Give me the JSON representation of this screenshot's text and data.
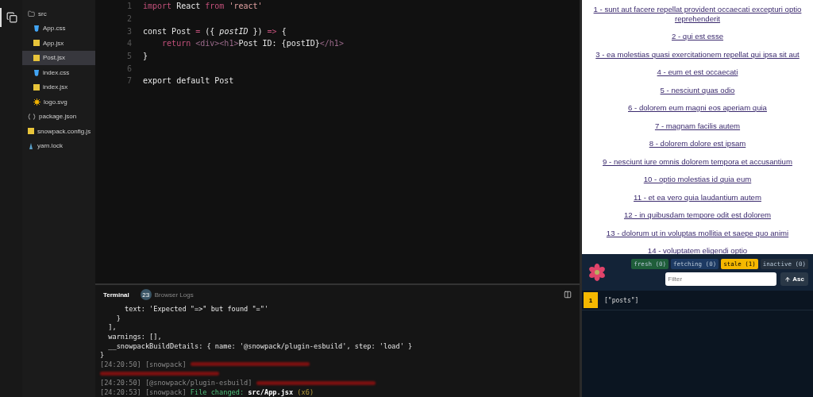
{
  "explorer": {
    "folder": "src",
    "files": [
      {
        "name": "App.css",
        "kind": "css",
        "selected": false,
        "nested": true
      },
      {
        "name": "App.jsx",
        "kind": "jsx",
        "selected": false,
        "nested": true
      },
      {
        "name": "Post.jsx",
        "kind": "jsx",
        "selected": true,
        "nested": true
      },
      {
        "name": "index.css",
        "kind": "css",
        "selected": false,
        "nested": true
      },
      {
        "name": "index.jsx",
        "kind": "jsx",
        "selected": false,
        "nested": true
      },
      {
        "name": "logo.svg",
        "kind": "svg",
        "selected": false,
        "nested": true
      },
      {
        "name": "package.json",
        "kind": "json",
        "selected": false,
        "nested": false
      },
      {
        "name": "snowpack.config.js",
        "kind": "jsx",
        "selected": false,
        "nested": false
      },
      {
        "name": "yarn.lock",
        "kind": "lock",
        "selected": false,
        "nested": false
      }
    ]
  },
  "editor": {
    "lines": [
      {
        "number": "1",
        "tokens": [
          {
            "text": "import",
            "kind": "keyword"
          },
          {
            "text": " React ",
            "kind": "plain"
          },
          {
            "text": "from",
            "kind": "keyword"
          },
          {
            "text": " 'react'",
            "kind": "string"
          }
        ]
      },
      {
        "number": "2"
      },
      {
        "number": "3",
        "tokens": [
          {
            "text": "const Post ",
            "kind": "plain"
          },
          {
            "text": "=",
            "kind": "keyword"
          },
          {
            "text": " ({ ",
            "kind": "plain"
          },
          {
            "text": "postID",
            "kind": "param"
          },
          {
            "text": " }) ",
            "kind": "plain"
          },
          {
            "text": "=>",
            "kind": "keyword"
          },
          {
            "text": " {",
            "kind": "plain"
          }
        ]
      },
      {
        "number": "4",
        "tokens": [
          {
            "text": "    return ",
            "kind": "keyword"
          },
          {
            "text": "<div>",
            "kind": "tag"
          },
          {
            "text": "<h1>",
            "kind": "tag"
          },
          {
            "text": "Post ID: {postID}",
            "kind": "plain"
          },
          {
            "text": "</h1>",
            "kind": "tag"
          }
        ]
      },
      {
        "number": "5",
        "tokens": [
          {
            "text": "}",
            "kind": "plain"
          }
        ]
      },
      {
        "number": "6"
      },
      {
        "number": "7",
        "tokens": [
          {
            "text": "export default Post",
            "kind": "plain"
          }
        ]
      }
    ]
  },
  "terminal": {
    "tabs": [
      {
        "label": "Terminal",
        "selected": true
      },
      {
        "label": "Browser Logs",
        "selected": false,
        "badge": "23"
      }
    ],
    "lines": [
      {
        "tokens": [
          {
            "text": "      text: 'Expected \"=>\" but found \"=\"'",
            "kind": "plain"
          }
        ]
      },
      {
        "tokens": [
          {
            "text": "    }",
            "kind": "plain"
          }
        ]
      },
      {
        "tokens": [
          {
            "text": "  ],",
            "kind": "plain"
          }
        ]
      },
      {
        "tokens": [
          {
            "text": "  warnings: [],",
            "kind": "plain"
          }
        ]
      },
      {
        "tokens": [
          {
            "text": "  __snowpackBuildDetails: { name: '@snowpack/plugin-esbuild', step: 'load' }",
            "kind": "plain"
          }
        ]
      },
      {
        "tokens": [
          {
            "text": "}",
            "kind": "plain"
          }
        ]
      },
      {
        "tokens": [
          {
            "text": "[24:20:50] [snowpack] ",
            "kind": "dim"
          },
          {
            "kind": "blurred"
          }
        ]
      },
      {
        "tokens": [
          {
            "kind": "blurred"
          }
        ]
      },
      {
        "tokens": [
          {
            "text": "[24:20:50] [@snowpack/plugin-esbuild] ",
            "kind": "dim"
          },
          {
            "kind": "blurred"
          }
        ]
      },
      {
        "tokens": [
          {
            "text": "[24:20:53] [snowpack] ",
            "kind": "dim"
          },
          {
            "text": "File changed: ",
            "kind": "green"
          },
          {
            "text": "src/App.jsx",
            "kind": "bold"
          },
          {
            "text": " (x6)",
            "kind": "yellow"
          }
        ]
      }
    ]
  },
  "posts": [
    "1 - sunt aut facere repellat provident occaecati excepturi optio reprehenderit",
    "2 - qui est esse",
    "3 - ea molestias quasi exercitationem repellat qui ipsa sit aut",
    "4 - eum et est occaecati",
    "5 - nesciunt quas odio",
    "6 - dolorem eum magni eos aperiam quia",
    "7 - magnam facilis autem",
    "8 - dolorem dolore est ipsam",
    "9 - nesciunt iure omnis dolorem tempora et accusantium",
    "10 - optio molestias id quia eum",
    "11 - et ea vero quia laudantium autem",
    "12 - in quibusdam tempore odit est dolorem",
    "13 - dolorum ut in voluptas mollitia et saepe quo animi",
    "14 - voluptatem eligendi optio"
  ],
  "devtools": {
    "filters": [
      {
        "label": "fresh (0)",
        "color": "#1f5e3a",
        "selected": false
      },
      {
        "label": "fetching (0)",
        "color": "#1d3a63",
        "selected": false
      },
      {
        "label": "stale (1)",
        "color": "#f5b800",
        "selected": true
      },
      {
        "label": "inactive (0)",
        "color": "#25303d",
        "selected": false
      }
    ],
    "filter": {
      "placeholder": "Filter"
    },
    "sort": "Asc",
    "queries": [
      {
        "count": "1",
        "key": "[\"posts\"]",
        "color": "#f5b800"
      }
    ]
  }
}
